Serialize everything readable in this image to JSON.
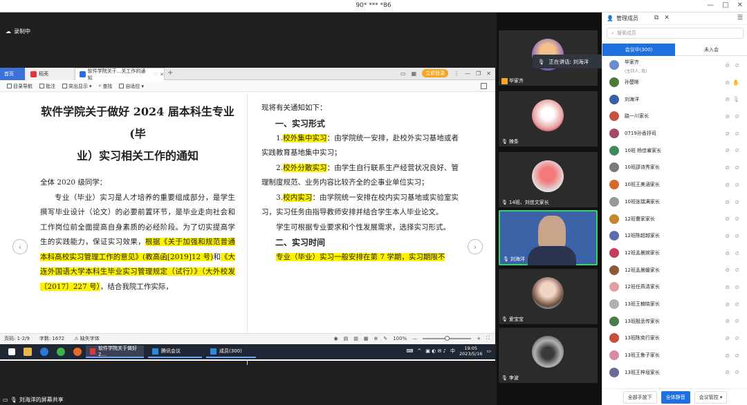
{
  "window": {
    "title": "90* *** *86"
  },
  "recording": {
    "label": "录制中"
  },
  "wps": {
    "tabs": [
      {
        "label": "首页"
      },
      {
        "label": "稻壳"
      },
      {
        "label": "软件学院关于...关工作的通知"
      }
    ],
    "login_label": "立即登录",
    "toolbar": [
      "目录导航",
      "批注",
      "突出显示",
      "查找",
      "自适应"
    ]
  },
  "document": {
    "title_line1": "软件学院关于做好 2024 届本科生专业(毕",
    "title_line2": "业）实习相关工作的通知",
    "salutation": "全体 2020 级同学：",
    "left_para_1": "专业（毕业）实习是人才培养的重要组成部分，是学生撰写毕业设计（论文）的必要前置环节，是毕业走向社会和工作岗位前全面提高自身素质的必经阶段。为了切实提高学生的实践能力，保证实习效果，",
    "left_hl_1": "根据《关于加强和规范普通本科高校实习管理工作的意见》(教高函[2019]12 号)",
    "left_mid": "和",
    "left_hl_2": "《大连外国语大学本科生毕业实习管理规定（试行）》（大外校发〔2017〕227 号）",
    "left_tail": "，结合我院工作实际，",
    "right_intro": "现将有关通知如下：",
    "h_form": "一、实习形式",
    "item1_num": "1.",
    "item1_hl": "校外集中实习",
    "item1_text": "：由学院统一安排，赴校外实习基地或者实践教育基地集中实习；",
    "item2_num": "2.",
    "item2_hl": "校外分散实习",
    "item2_text": "：由学生自行联系生产经营状况良好、管理制度规范、业务内容比较齐全的企事业单位实习；",
    "item3_num": "3.",
    "item3_hl": "校内实习",
    "item3_text": "：由学院统一安排在校内实习基地或实验室实习，实习任务由指导教师安排并结合学生本人毕业论文。",
    "right_para": "学生可根据专业要求和个性发展需求，选择实习形式。",
    "h_time": "二、实习时间",
    "time_hl": "专业（毕业）实习一般安排在第 7 学期，实习期限不"
  },
  "statusbar": {
    "page": "页码: 1-2/9",
    "words": "字数: 1672",
    "font": "缺失字体",
    "zoom": "100%",
    "zoom_fraction": 0.5
  },
  "taskbar": {
    "apps": [
      "软件学院关于做好2...",
      "腾讯会议",
      "成员(300)"
    ],
    "time": "19:05",
    "date": "2023/5/16"
  },
  "share_footer": "刘海洋的屏幕共享",
  "speaking": {
    "label": "正在讲话: 刘海洋"
  },
  "video_tiles": [
    {
      "name": "毕家齐"
    },
    {
      "name": "辣条"
    },
    {
      "name": "14班、刘佳文家长"
    },
    {
      "name": "刘海洋"
    },
    {
      "name": "爱宝宝"
    },
    {
      "name": "李波"
    }
  ],
  "members_panel": {
    "title": "管理成员",
    "search_placeholder": "搜索成员",
    "tab_in": "会议中(300)",
    "tab_out": "未入会",
    "members": [
      {
        "name": "毕家齐",
        "sub": "(主持人, 我)",
        "color": "#6a8bd1"
      },
      {
        "name": "孙楚晰",
        "color": "#4c7a3a"
      },
      {
        "name": "刘海洋",
        "color": "#3a5fa8"
      },
      {
        "name": "路一川家长",
        "color": "#c9503a"
      },
      {
        "name": "0719孙香抒司",
        "color": "#a34a6c"
      },
      {
        "name": "10班 杨佳睿家长",
        "color": "#3d8a5d"
      },
      {
        "name": "10班邵诗秀家长",
        "color": "#7a7a7a"
      },
      {
        "name": "10班王美涵家长",
        "color": "#d46a2a"
      },
      {
        "name": "10班张瑞满家长",
        "color": "#999999"
      },
      {
        "name": "12班曹家家长",
        "color": "#c8862e"
      },
      {
        "name": "12班陈超越家长",
        "color": "#5a6fb0"
      },
      {
        "name": "12班孟晨婉家长",
        "color": "#c43d5a"
      },
      {
        "name": "12班孟晨媛家长",
        "color": "#8a5a3a"
      },
      {
        "name": "12班任燕清家长",
        "color": "#e0a0a0"
      },
      {
        "name": "13班王楠晓家长",
        "color": "#b0b0b0"
      },
      {
        "name": "13班殷丞传家长",
        "color": "#4a7a4a"
      },
      {
        "name": "13班陈奕行家长",
        "color": "#c8503a"
      },
      {
        "name": "13班王鲁子家长",
        "color": "#d98aa0"
      },
      {
        "name": "13班王梓垣家长",
        "color": "#6a6a9a"
      }
    ],
    "btn_all_hands_down": "全部手放下",
    "btn_mute_all": "全体静音",
    "btn_control": "会议管控"
  }
}
